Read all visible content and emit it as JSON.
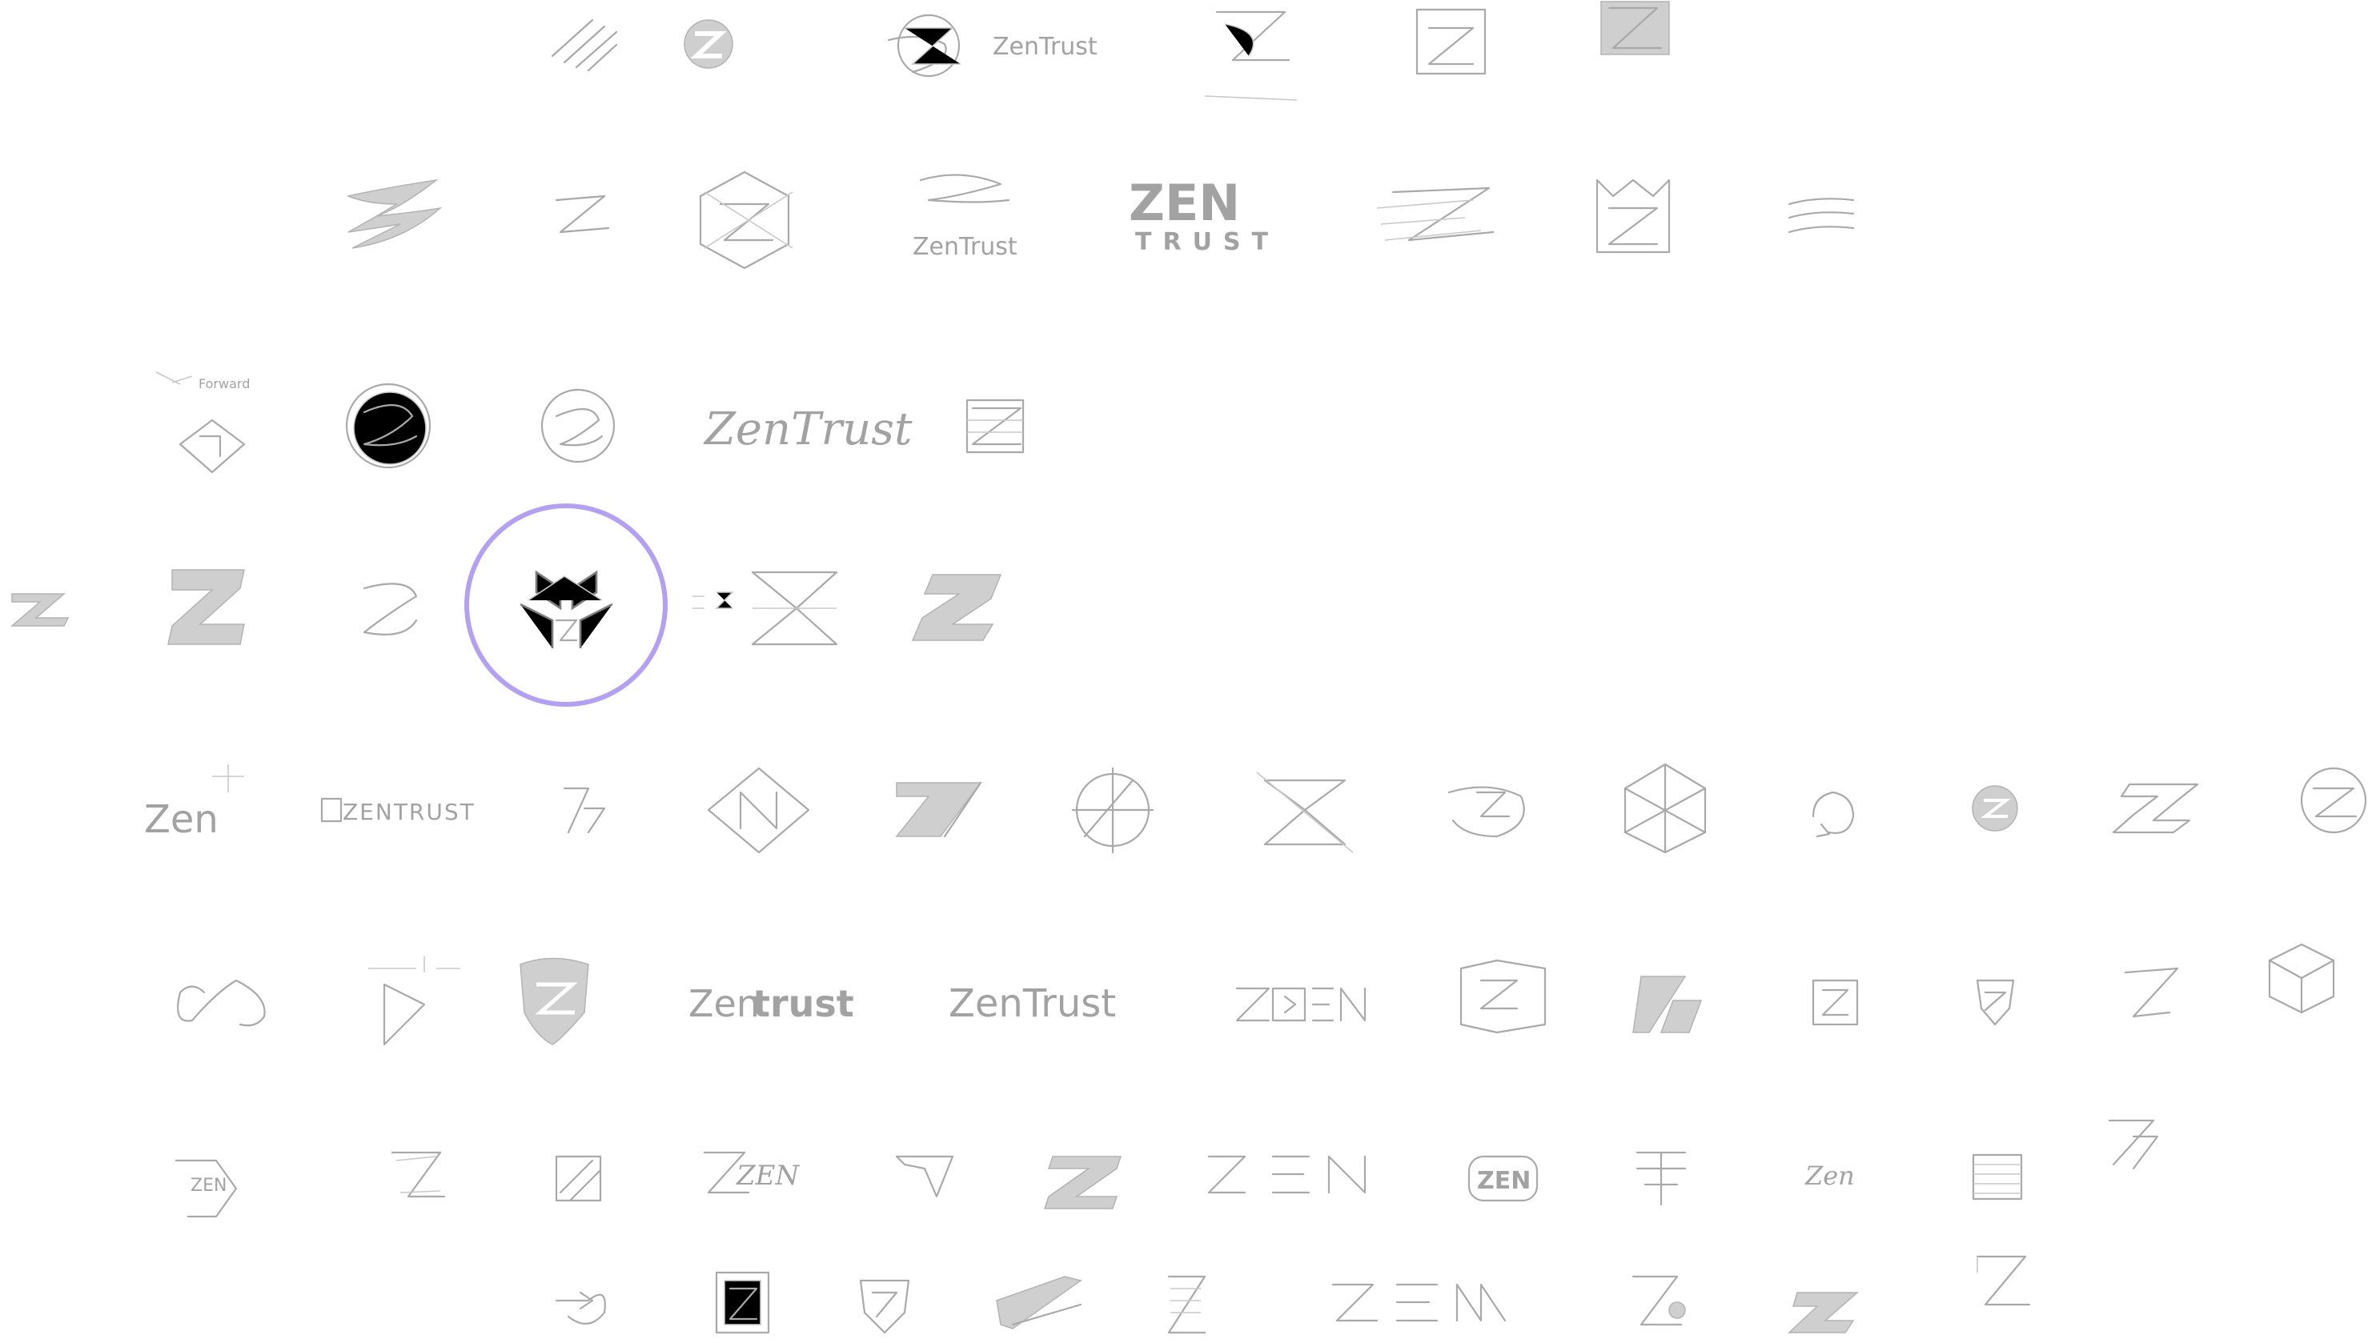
{
  "board": {
    "background": "#ffffff",
    "sketch_color": "#a9a9a9",
    "highlight_color": "#b3a0f0",
    "highlighted_sketch": "three-arrow-z-mark"
  },
  "wordmarks": {
    "zentrust_row1": "ZenTrust",
    "zentrust_row2": "ZenTrust",
    "zen_big": "ZEN",
    "trust_big": "TRUST",
    "zentrust_script": "ZenTrust",
    "zen_small": "Zen",
    "zentrust_caps": "ZENTRUST",
    "zentrust_mixed_zen": "Zen",
    "zentrust_mixed_trust": "trust",
    "zentrust_thin": "ZenTrust",
    "zen_row7": "ZEN",
    "zen_row8": "ZEN"
  }
}
